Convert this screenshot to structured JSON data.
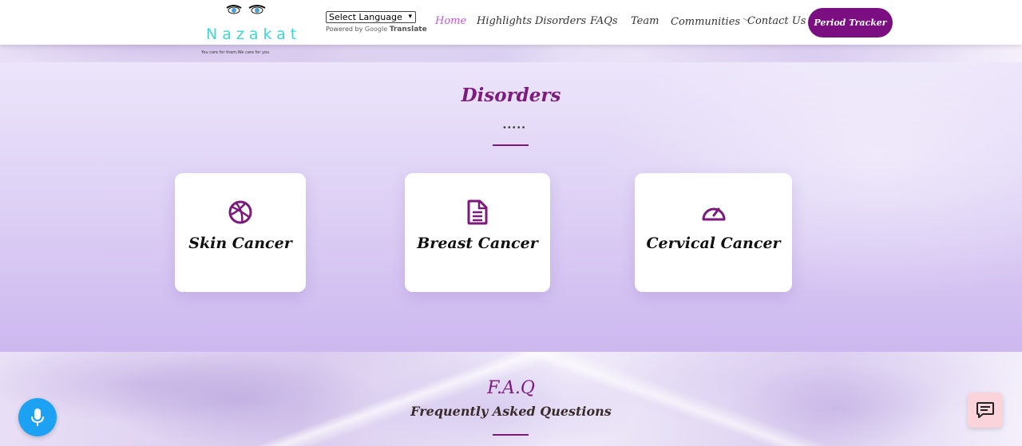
{
  "header": {
    "logo_text": "Nazakat",
    "tagline": "You care for them,We care for you",
    "language": {
      "selected": "Select Language",
      "powered_by": "Powered by",
      "google": "Google",
      "translate": "Translate"
    },
    "nav": [
      {
        "label": "Home",
        "active": true
      },
      {
        "label": "Highlights"
      },
      {
        "label": "Disorders"
      },
      {
        "label": "FAQs"
      },
      {
        "label": "Team"
      },
      {
        "label": "Communities",
        "has_dropdown": true
      },
      {
        "label": "Contact Us"
      }
    ],
    "cta_label": "Period Tracker"
  },
  "disorders": {
    "title": "Disorders",
    "divider_dots": "•••••",
    "cards": [
      {
        "label": "Skin Cancer",
        "icon": "basketball-icon"
      },
      {
        "label": "Breast Cancer",
        "icon": "document-icon"
      },
      {
        "label": "Cervical Cancer",
        "icon": "speedometer-icon"
      }
    ]
  },
  "faq": {
    "title": "F.A.Q",
    "subtitle": "Frequently Asked Questions"
  },
  "widgets": {
    "mic_icon": "microphone-icon",
    "chat_icon": "chat-icon"
  },
  "colors": {
    "accent": "#7b0f82",
    "active_nav": "#c158d6",
    "logo": "#3fd6d0",
    "mic": "#1da1f2",
    "chat": "#fbd3da"
  }
}
